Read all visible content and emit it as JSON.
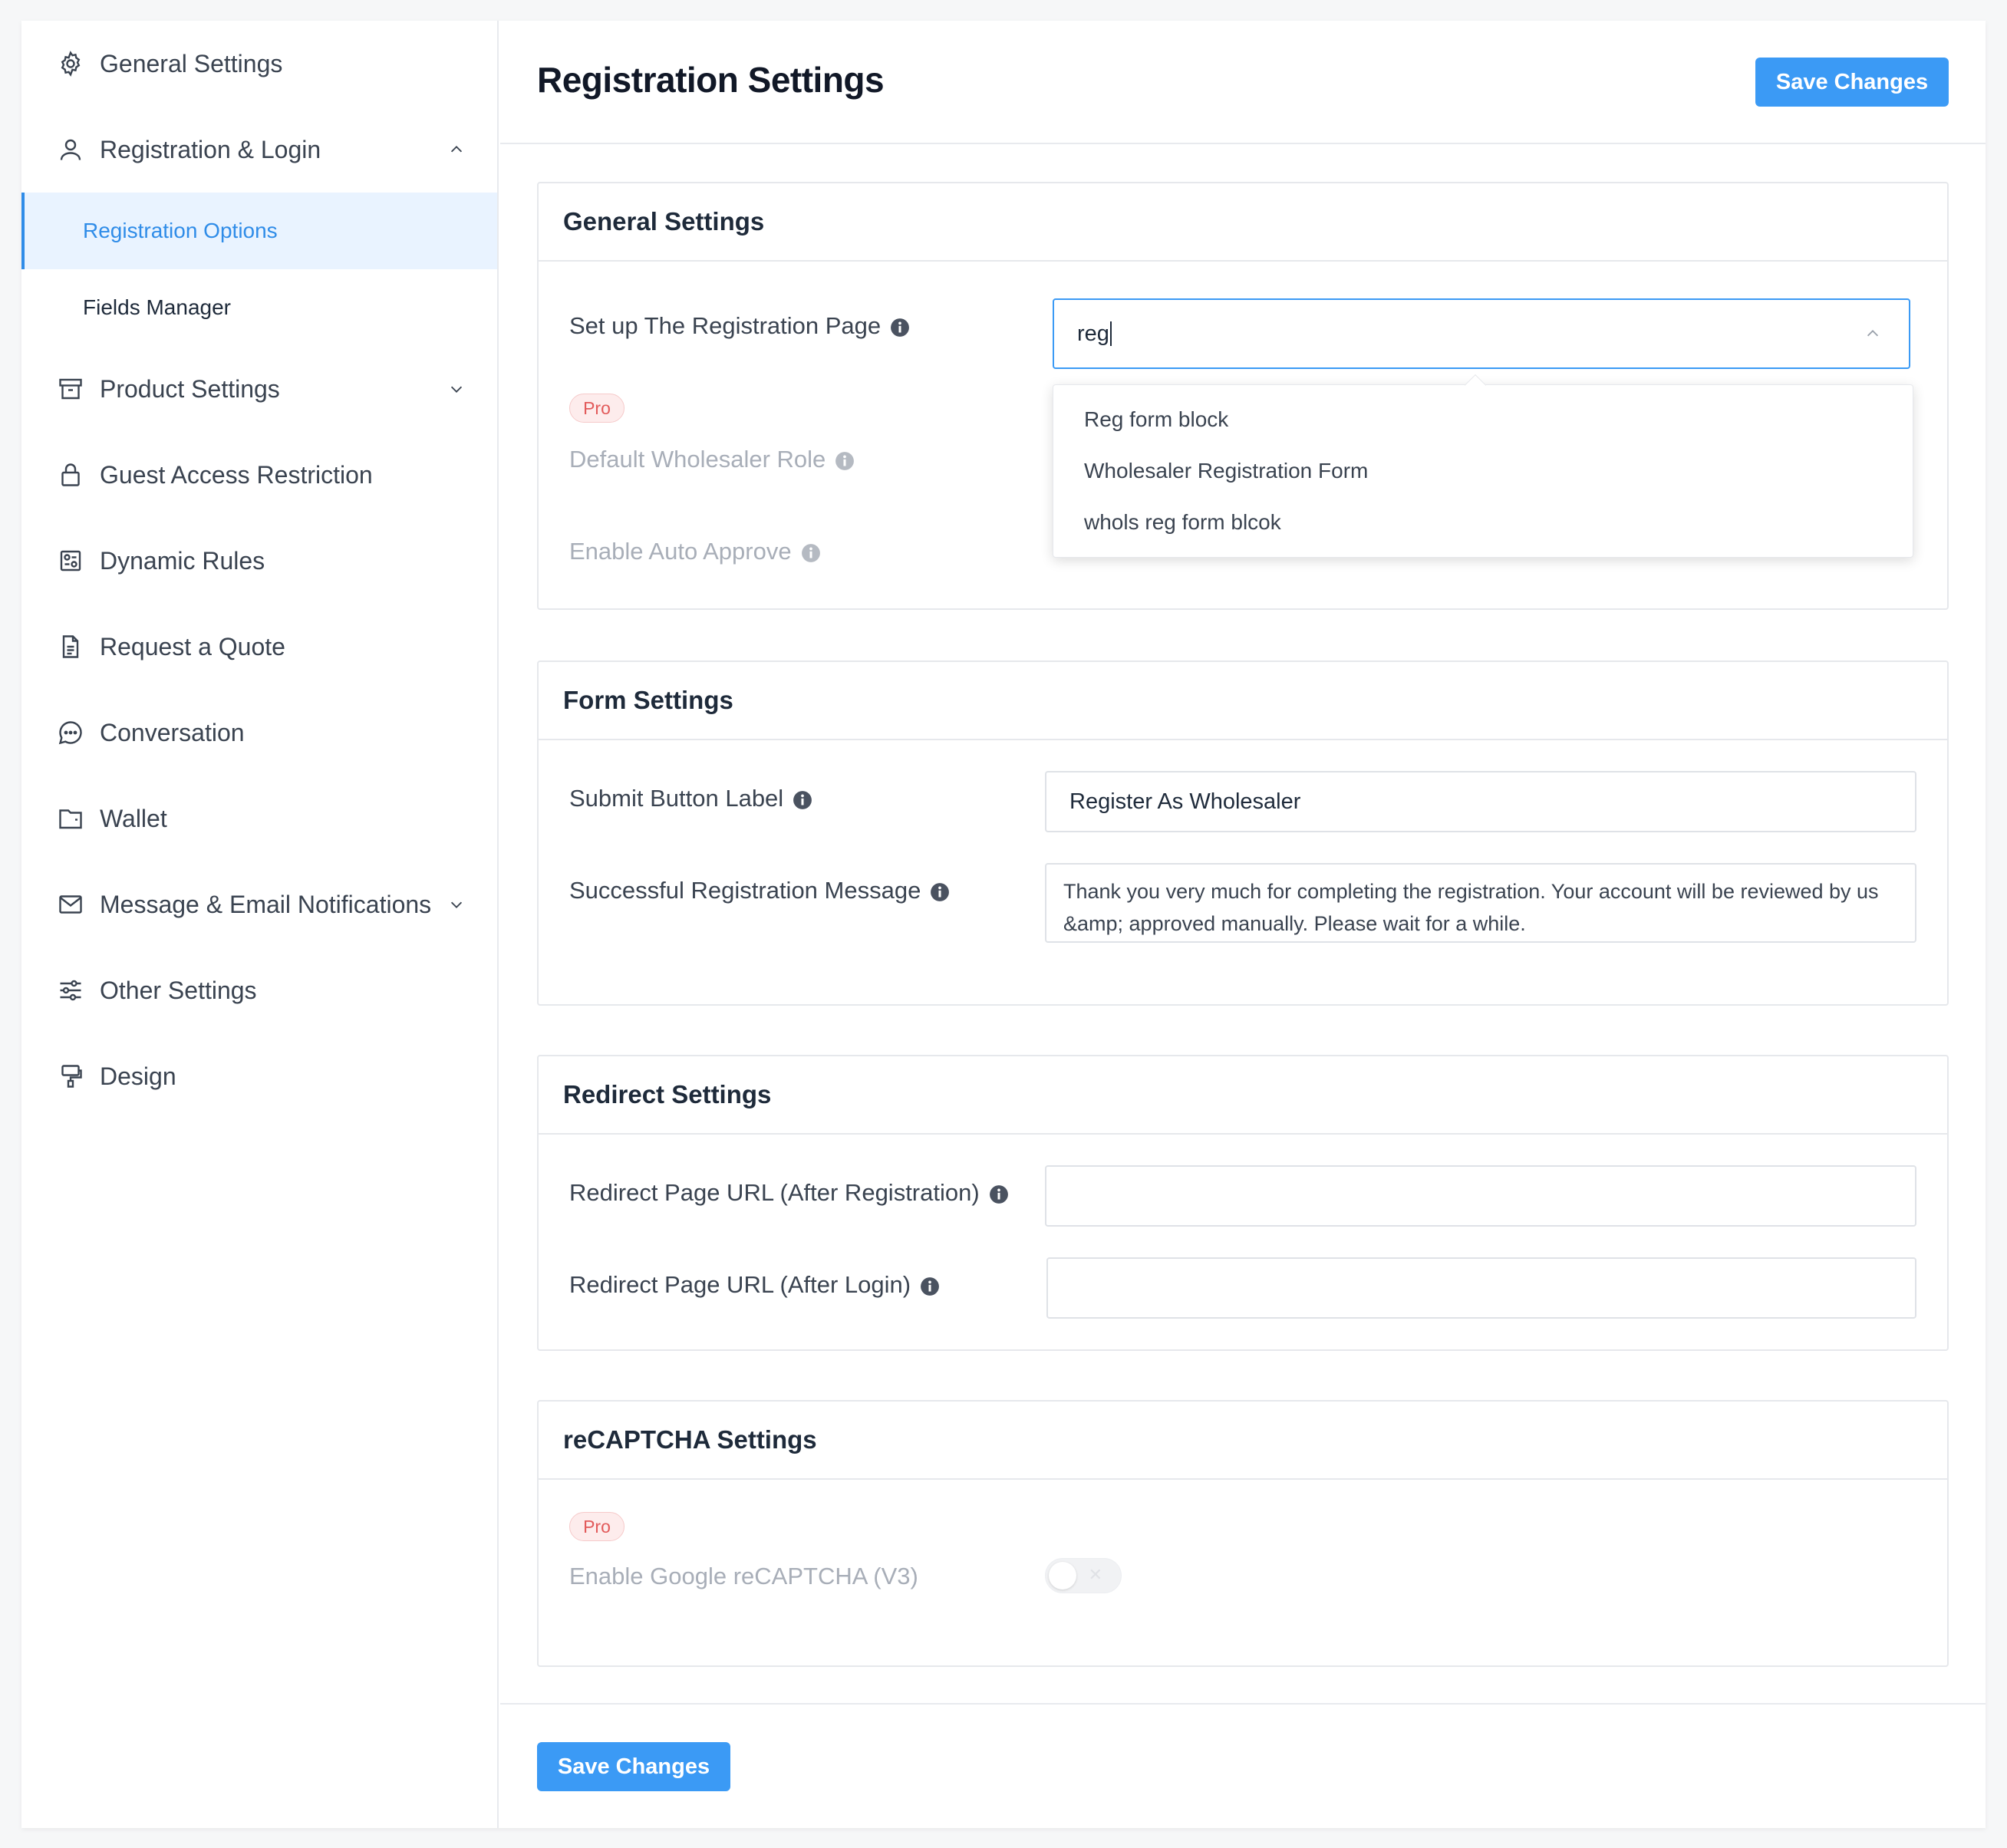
{
  "page_title": "Registration Settings",
  "save_label": "Save Changes",
  "sidebar": {
    "items": [
      {
        "label": "General Settings",
        "icon": "gear-icon"
      },
      {
        "label": "Registration & Login",
        "icon": "user-icon"
      },
      {
        "label": "Product Settings",
        "icon": "archive-icon"
      },
      {
        "label": "Guest Access Restriction",
        "icon": "lock-icon"
      },
      {
        "label": "Dynamic Rules",
        "icon": "rules-icon"
      },
      {
        "label": "Request a Quote",
        "icon": "document-icon"
      },
      {
        "label": "Conversation",
        "icon": "chat-icon"
      },
      {
        "label": "Wallet",
        "icon": "wallet-icon"
      },
      {
        "label": "Message & Email Notifications",
        "icon": "mail-icon"
      },
      {
        "label": "Other Settings",
        "icon": "sliders-icon"
      },
      {
        "label": "Design",
        "icon": "paint-icon"
      }
    ],
    "sub_items": [
      {
        "label": "Registration Options",
        "active": true
      },
      {
        "label": "Fields Manager",
        "active": false
      }
    ]
  },
  "general_settings": {
    "title": "General Settings",
    "registration_page_label": "Set up The Registration Page",
    "registration_page_query": "reg",
    "dropdown_options": [
      "Reg form block",
      "Wholesaler Registration Form",
      "whols reg form blcok"
    ],
    "pro_badge": "Pro",
    "default_role_label": "Default Wholesaler Role",
    "auto_approve_label": "Enable Auto Approve"
  },
  "form_settings": {
    "title": "Form Settings",
    "submit_label": "Submit Button Label",
    "submit_value": "Register As Wholesaler",
    "success_label": "Successful Registration Message",
    "success_value": "Thank you very much for completing the registration. Your account will be reviewed by us &amp; approved manually. Please wait for a while."
  },
  "redirect_settings": {
    "title": "Redirect Settings",
    "after_registration_label": "Redirect Page URL (After Registration)",
    "after_registration_value": "",
    "after_login_label": "Redirect Page URL (After Login)",
    "after_login_value": ""
  },
  "recaptcha_settings": {
    "title": "reCAPTCHA Settings",
    "pro_badge": "Pro",
    "enable_label": "Enable Google reCAPTCHA (V3)"
  },
  "colors": {
    "accent": "#3b9af5",
    "active_bg": "#e9f3ff",
    "pro_red": "#e25a5a"
  }
}
